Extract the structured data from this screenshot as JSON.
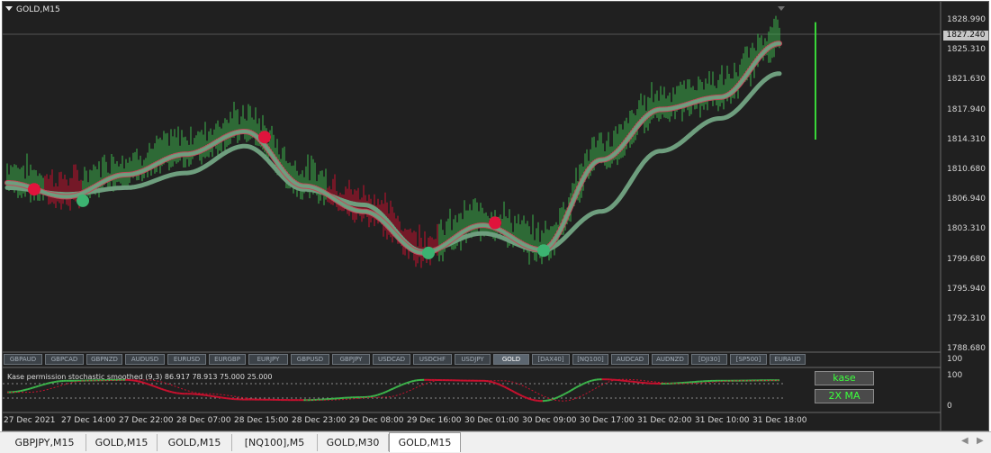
{
  "window": {
    "title": "GOLD,M15"
  },
  "price_axis": {
    "labels": [
      "1828.990",
      "1825.310",
      "1821.630",
      "1817.940",
      "1814.310",
      "1810.680",
      "1806.940",
      "1803.310",
      "1799.680",
      "1795.940",
      "1792.310",
      "1788.680"
    ],
    "current_price": "1827.240"
  },
  "time_axis": {
    "labels": [
      "27 Dec 2021",
      "27 Dec 14:00",
      "27 Dec 22:00",
      "28 Dec 07:00",
      "28 Dec 15:00",
      "28 Dec 23:00",
      "29 Dec 08:00",
      "29 Dec 16:00",
      "30 Dec 01:00",
      "30 Dec 09:00",
      "30 Dec 17:00",
      "31 Dec 02:00",
      "31 Dec 10:00",
      "31 Dec 18:00"
    ]
  },
  "symbol_bar": {
    "symbols": [
      "GBPAUD",
      "GBPCAD",
      "GBPNZD",
      "AUDUSD",
      "EURUSD",
      "EURGBP",
      "EURJPY",
      "GBPUSD",
      "GBPJPY",
      "USDCAD",
      "USDCHF",
      "USDJPY",
      "GOLD",
      "[DAX40]",
      "[NQ100]",
      "AUDCAD",
      "AUDNZD",
      "[DJI30]",
      "[SP500]",
      "EURAUD"
    ],
    "active": "GOLD"
  },
  "indicator": {
    "title": "Kase permission stochastic smoothed (9,3) 86.917 78.913 75.000 25.000",
    "scale_max": "100",
    "scale_top": "100",
    "scale_bottom": "0",
    "buttons": {
      "kase": "kase",
      "ma": "2X MA"
    }
  },
  "tabs": {
    "items": [
      "GBPJPY,M15",
      "GOLD,M15",
      "GOLD,M15",
      "[NQ100],M5",
      "GOLD,M30",
      "GOLD,M15"
    ],
    "active_index": 5,
    "left_arrow": "◀",
    "right_arrow": "▶"
  },
  "colors": {
    "background": "#202020",
    "bull": "#3cb44b",
    "bear": "#c8102e",
    "ma": "#6e9e7e",
    "up_dot": "#3cb371",
    "down_dot": "#e0143c"
  },
  "chart_data": [
    {
      "type": "line",
      "title": "GOLD,M15",
      "ylim": [
        1788.68,
        1828.99
      ],
      "x": [
        "27 Dec 2021",
        "27 Dec 14:00",
        "27 Dec 22:00",
        "28 Dec 07:00",
        "28 Dec 15:00",
        "28 Dec 23:00",
        "29 Dec 08:00",
        "29 Dec 16:00",
        "30 Dec 01:00",
        "30 Dec 09:00",
        "30 Dec 17:00",
        "31 Dec 02:00",
        "31 Dec 10:00",
        "31 Dec 18:00"
      ],
      "series": [
        {
          "values": [
            1809.0,
            1807.3,
            1810.0,
            1812.5,
            1815.3,
            1808.6,
            1805.5,
            1800.4,
            1803.8,
            1800.8,
            1811.8,
            1818.0,
            1819.5,
            1826.1
          ]
        },
        {
          "values": [
            1808.4,
            1807.6,
            1808.4,
            1810.2,
            1813.5,
            1808.2,
            1806.3,
            1800.6,
            1802.8,
            1800.7,
            1805.5,
            1812.9,
            1816.9,
            1822.4
          ]
        }
      ],
      "signals": [
        {
          "x": "27 Dec 2021",
          "value": 1808.2,
          "kind": "down"
        },
        {
          "x": "27 Dec 14:00",
          "value": 1806.8,
          "kind": "up"
        },
        {
          "x": "28 Dec 15:00",
          "value": 1814.6,
          "kind": "down"
        },
        {
          "x": "29 Dec 16:00",
          "value": 1800.4,
          "kind": "up"
        },
        {
          "x": "30 Dec 01:00",
          "value": 1804.1,
          "kind": "down"
        },
        {
          "x": "30 Dec 09:00",
          "value": 1800.7,
          "kind": "up"
        }
      ]
    },
    {
      "type": "line",
      "title": "Kase permission stochastic smoothed (9,3) 86.917 78.913 75.000 25.000",
      "ylim": [
        0,
        100
      ],
      "levels": [
        75,
        25
      ],
      "x": [
        "27 Dec 2021",
        "27 Dec 14:00",
        "27 Dec 22:00",
        "28 Dec 07:00",
        "28 Dec 15:00",
        "28 Dec 23:00",
        "29 Dec 08:00",
        "29 Dec 16:00",
        "30 Dec 01:00",
        "30 Dec 09:00",
        "30 Dec 17:00",
        "31 Dec 02:00",
        "31 Dec 10:00",
        "31 Dec 18:00"
      ],
      "series": [
        {
          "values": [
            45,
            85,
            88,
            40,
            20,
            18,
            28,
            88,
            85,
            15,
            90,
            75,
            85,
            86.917
          ]
        }
      ]
    }
  ]
}
